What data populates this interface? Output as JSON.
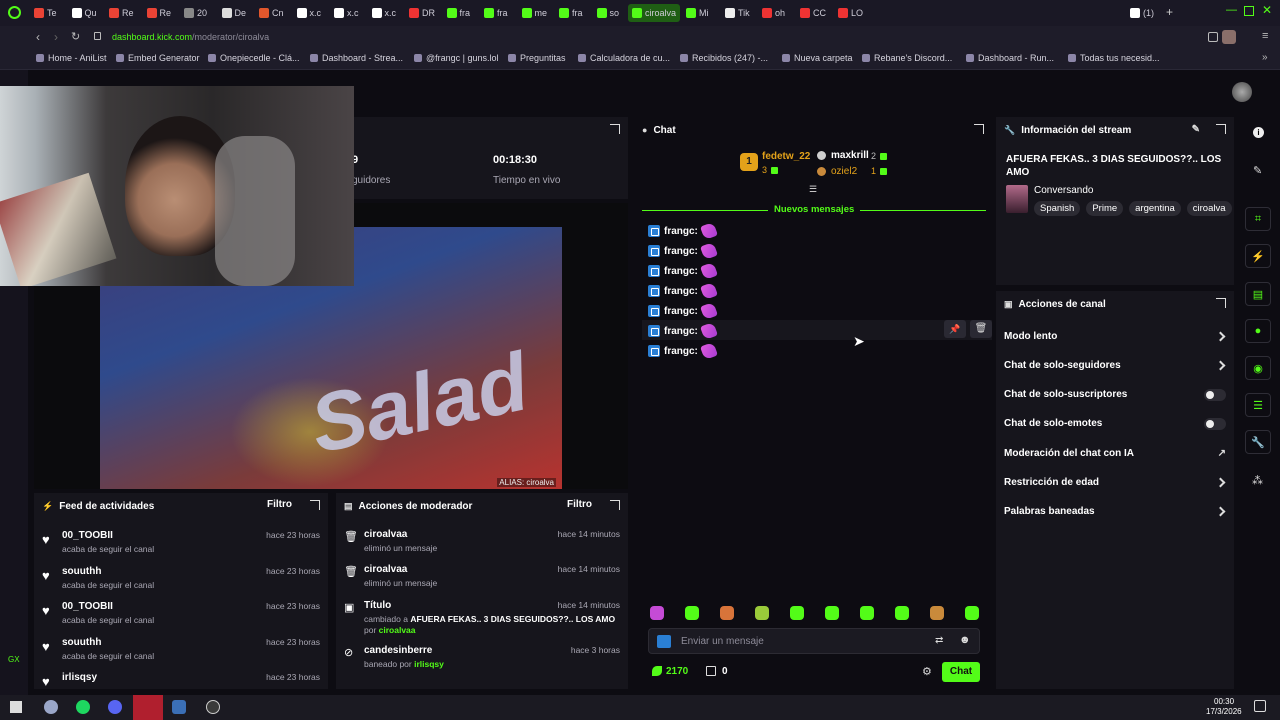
{
  "browser": {
    "tabs": [
      "Te",
      "Qu",
      "Re",
      "Re",
      "20",
      "De",
      "Cn",
      "x.c",
      "x.c",
      "x.c",
      "DR",
      "fra",
      "fra",
      "me",
      "fra",
      "so",
      "ciroalva",
      "Mi",
      "Tik",
      "oh",
      "CC",
      "LO",
      "(1)"
    ],
    "url_host": "dashboard.kick.com",
    "url_path": "/moderator/ciroalva",
    "bookmarks": [
      "Home - AniList",
      "Embed Generator",
      "Onepiecedle - Clá...",
      "Dashboard - Strea...",
      "@frangc | guns.lol",
      "Preguntitas",
      "Calculadora de cu...",
      "Recibidos (247) -...",
      "Nueva carpeta",
      "Rebane's Discord...",
      "Dashboard - Run...",
      "Todas tus necesid..."
    ]
  },
  "stats": {
    "followers_value": "9",
    "followers_label": "guidores",
    "time_value": "00:18:30",
    "time_label": "Tiempo en vivo"
  },
  "video": {
    "alias": "ALIAS: ciroalva",
    "package_text": "Salad"
  },
  "feed": {
    "title": "Feed de actividades",
    "filter": "Filtro",
    "items": [
      {
        "name": "00_TOOBII",
        "sub": "acaba de seguir el canal",
        "time": "hace 23 horas"
      },
      {
        "name": "souuthh",
        "sub": "acaba de seguir el canal",
        "time": "hace 23 horas"
      },
      {
        "name": "00_TOOBII",
        "sub": "acaba de seguir el canal",
        "time": "hace 23 horas"
      },
      {
        "name": "souuthh",
        "sub": "acaba de seguir el canal",
        "time": "hace 23 horas"
      },
      {
        "name": "irlisqsy",
        "sub": "",
        "time": "hace 23 horas"
      }
    ]
  },
  "modactions": {
    "title": "Acciones de moderador",
    "filter": "Filtro",
    "items": [
      {
        "name": "ciroalvaa",
        "sub": "eliminó un mensaje",
        "time": "hace 14 minutos"
      },
      {
        "name": "ciroalvaa",
        "sub": "eliminó un mensaje",
        "time": "hace 14 minutos"
      },
      {
        "name": "Título",
        "sub_pre": "cambiado a ",
        "sub_bold": "AFUERA FEKAS.. 3 DIAS SEGUIDOS??.. LOS AMO",
        "sub_mid": " por ",
        "sub_user": "ciroalvaa",
        "time": "hace 14 minutos"
      },
      {
        "name": "candesinberre",
        "sub_pre": "baneado por ",
        "sub_user": "irlisqsy",
        "time": "hace 3 horas"
      }
    ]
  },
  "chat": {
    "title": "Chat",
    "leader_rank": "1",
    "leader_name": "fedetw_22",
    "leader_count": "3",
    "second_name": "maxkrill",
    "second_count": "2",
    "third_name": "oziel2",
    "third_count": "1",
    "new_messages": "Nuevos mensajes",
    "messages": [
      "frangc:",
      "frangc:",
      "frangc:",
      "frangc:",
      "frangc:",
      "frangc:",
      "frangc:"
    ],
    "input_placeholder": "Enviar un mensaje",
    "points": "2170",
    "gifts": "0",
    "send": "Chat"
  },
  "streaminfo": {
    "title": "Información del stream",
    "stream_title": "AFUERA FEKAS.. 3 DIAS SEGUIDOS??.. LOS AMO",
    "category": "Conversando",
    "tags": [
      "Spanish",
      "Prime",
      "argentina",
      "ciroalva"
    ]
  },
  "actions": {
    "title": "Acciones de canal",
    "items": [
      {
        "label": "Modo lento",
        "kind": "chevron"
      },
      {
        "label": "Chat de solo-seguidores",
        "kind": "chevron"
      },
      {
        "label": "Chat de solo-suscriptores",
        "kind": "toggle"
      },
      {
        "label": "Chat de solo-emotes",
        "kind": "toggle"
      },
      {
        "label": "Moderación del chat con IA",
        "kind": "external"
      },
      {
        "label": "Restricción de edad",
        "kind": "chevron"
      },
      {
        "label": "Palabras baneadas",
        "kind": "chevron"
      }
    ]
  },
  "taskbar": {
    "time": "00:30",
    "date": "17/3/2026"
  },
  "colors": {
    "accent": "#53fc18",
    "panel": "#16151c",
    "bg": "#0d0c12"
  }
}
